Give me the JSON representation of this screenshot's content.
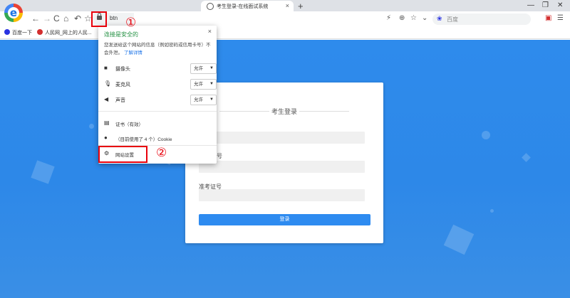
{
  "browser": {
    "logo_letter": "e",
    "tab": {
      "title": "考生登录-在线面试系统",
      "close": "×"
    },
    "new_tab": "+",
    "window_controls": [
      "—",
      "❐",
      "✕"
    ],
    "nav": {
      "back": "←",
      "forward": "→",
      "reload": "C",
      "home": "⌂",
      "undo": "↶",
      "star": "☆"
    },
    "address_text": "btn",
    "search_placeholder": "百度",
    "bookmarks": [
      {
        "label": "百度一下",
        "icon_color": "#2932e1"
      },
      {
        "label": "人民网_网上的人民...",
        "icon_color": "#d32f2f"
      }
    ]
  },
  "annotations": {
    "step1": "①",
    "step2": "②",
    "color": "#e8000b"
  },
  "popup": {
    "close": "×",
    "title": "连接是安全的",
    "description": "您发送给这个网站的信息（例如密码或信用卡号）不会外泄。",
    "learn_more": "了解详情",
    "permissions": [
      {
        "icon": "camera-icon",
        "label": "摄像头",
        "value": "允许"
      },
      {
        "icon": "microphone-icon",
        "label": "麦克风",
        "value": "允许"
      },
      {
        "icon": "sound-icon",
        "label": "声音",
        "value": "允许"
      }
    ],
    "certificate": "证书（有效）",
    "cookie": "（目前使用了 4 个）Cookie",
    "site_settings": "网站设置"
  },
  "login": {
    "title": "考生登录",
    "field2_label_partial": "号",
    "field3_label": "准考证号",
    "button": "登录"
  },
  "colors": {
    "page_bg": "#2e8bec",
    "accent": "#2e8bf0",
    "secure_green": "#1e8e3e"
  }
}
